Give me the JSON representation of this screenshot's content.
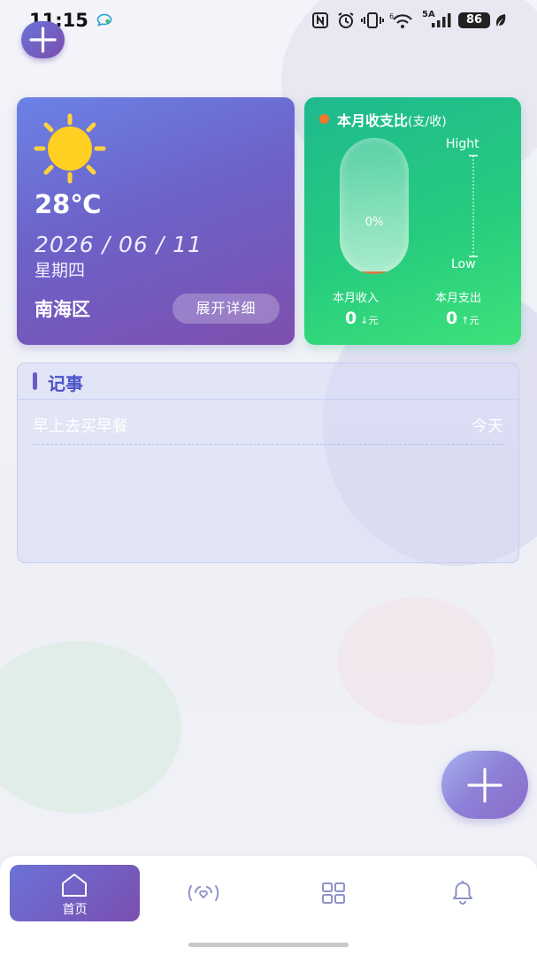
{
  "status_bar": {
    "time": "11:15",
    "network": "5A",
    "battery": "86"
  },
  "weather": {
    "temperature": "28℃",
    "date": "2026 / 06 / 11",
    "weekday": "星期四",
    "district": "南海区",
    "expand_label": "展开详细",
    "icon": "sun-icon"
  },
  "finance": {
    "title": "本月收支比",
    "title_suffix": "(支/收)",
    "ratio_percent": "0%",
    "ratio_value": 0,
    "high_label": "Hight",
    "low_label": "Low",
    "income_label": "本月收入",
    "expense_label": "本月支出",
    "income_value": "0",
    "income_unit": "↓元",
    "expense_value": "0",
    "expense_unit": "↑元",
    "accent_color": "#f07828"
  },
  "notes": {
    "title": "记事",
    "items": [
      {
        "text": "早上去买早餐",
        "date": "今天"
      }
    ]
  },
  "nav": {
    "home_label": "首页",
    "items": [
      "home-icon",
      "broadcast-icon",
      "grid-icon",
      "bell-icon"
    ]
  },
  "colors": {
    "primary": "#6b72d8",
    "primary_dark": "#7a4fb0",
    "finance_green": "#26cc7e"
  }
}
